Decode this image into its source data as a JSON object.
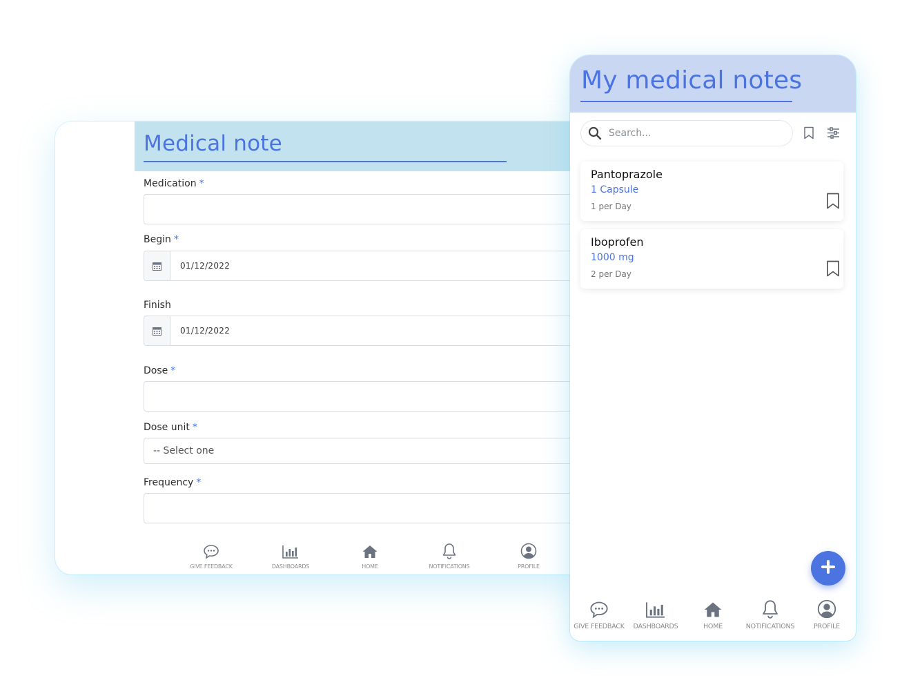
{
  "form": {
    "title": "Medical note",
    "fields": {
      "medication": {
        "label": "Medication",
        "required_mark": "*",
        "value": ""
      },
      "begin": {
        "label": "Begin",
        "required_mark": "*",
        "value": "01/12/2022"
      },
      "finish": {
        "label": "Finish",
        "value": "01/12/2022"
      },
      "dose": {
        "label": "Dose",
        "required_mark": "*",
        "value": ""
      },
      "dose_unit": {
        "label": "Dose unit",
        "required_mark": "*",
        "selected": "-- Select one"
      },
      "frequency": {
        "label": "Frequency",
        "required_mark": "*",
        "value": ""
      }
    },
    "nav": [
      {
        "label": "GIVE FEEDBACK",
        "icon": "chat-bubble-icon"
      },
      {
        "label": "DASHBOARDS",
        "icon": "bar-chart-icon"
      },
      {
        "label": "HOME",
        "icon": "home-icon"
      },
      {
        "label": "NOTIFICATIONS",
        "icon": "bell-icon"
      },
      {
        "label": "PROFILE",
        "icon": "user-circle-icon"
      }
    ]
  },
  "notes_screen": {
    "title": "My medical notes",
    "search": {
      "placeholder": "Search...",
      "icon": "search-icon"
    },
    "toolbar_icons": [
      "bookmark-icon",
      "filter-sliders-icon"
    ],
    "notes": [
      {
        "name": "Pantoprazole",
        "dose": "1 Capsule",
        "frequency": "1 per Day",
        "icon": "bookmark-icon"
      },
      {
        "name": "Iboprofen",
        "dose": "1000 mg",
        "frequency": "2 per Day",
        "icon": "bookmark-icon"
      }
    ],
    "fab_icon": "plus-icon",
    "nav": [
      {
        "label": "GIVE FEEDBACK",
        "icon": "chat-bubble-icon"
      },
      {
        "label": "DASHBOARDS",
        "icon": "bar-chart-icon"
      },
      {
        "label": "HOME",
        "icon": "home-icon"
      },
      {
        "label": "NOTIFICATIONS",
        "icon": "bell-icon"
      },
      {
        "label": "PROFILE",
        "icon": "user-circle-icon"
      }
    ]
  },
  "colors": {
    "accent": "#4b74e0",
    "form_header_bg": "#c2e2ef",
    "notes_header_bg": "#c9d7f2",
    "glow": "#a8e4f5"
  }
}
